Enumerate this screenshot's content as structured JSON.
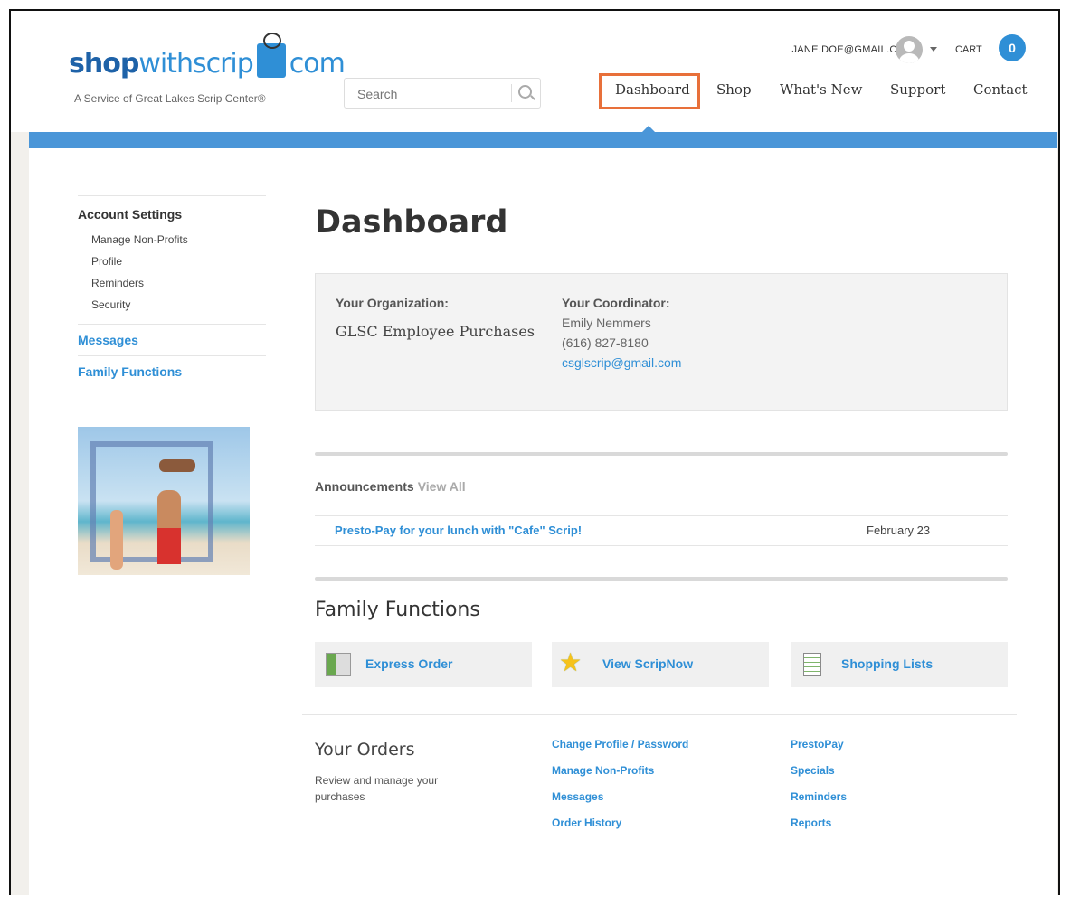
{
  "brand": {
    "logo_shop": "shop",
    "logo_withscrip": "withscrip",
    "logo_com": "com",
    "tagline": "A Service of Great Lakes Scrip Center®"
  },
  "header": {
    "search_placeholder": "Search",
    "account_email": "JANE.DOE@GMAIL.COM",
    "cart_label": "CART",
    "cart_count": "0",
    "nav": [
      "Dashboard",
      "Shop",
      "What's New",
      "Support",
      "Contact"
    ],
    "active_nav": "Dashboard"
  },
  "sidebar": {
    "account_settings": "Account Settings",
    "settings_items": [
      "Manage Non-Profits",
      "Profile",
      "Reminders",
      "Security"
    ],
    "messages": "Messages",
    "family_functions": "Family Functions"
  },
  "main": {
    "title": "Dashboard",
    "org_label": "Your Organization:",
    "org_name": "GLSC Employee Purchases",
    "coord_label": "Your Coordinator:",
    "coord_name": "Emily Nemmers",
    "coord_phone": "(616) 827-8180",
    "coord_email": "csglscrip@gmail.com",
    "announcements_label": "Announcements",
    "view_all": "View All",
    "announcement": {
      "title": "Presto-Pay for your lunch with \"Cafe\" Scrip!",
      "date": "February 23"
    },
    "family_functions_title": "Family Functions",
    "ff_buttons": [
      "Express Order",
      "View ScripNow",
      "Shopping Lists"
    ],
    "your_orders_title": "Your Orders",
    "your_orders_desc": "Review and manage your purchases",
    "links_col1": [
      "Change Profile / Password",
      "Manage Non-Profits",
      "Messages",
      "Order History"
    ],
    "links_col2": [
      "PrestoPay",
      "Specials",
      "Reminders",
      "Reports"
    ]
  },
  "colors": {
    "brand_blue": "#2f8fd6",
    "bar_blue": "#4a96d8",
    "highlight": "#e8703a"
  }
}
